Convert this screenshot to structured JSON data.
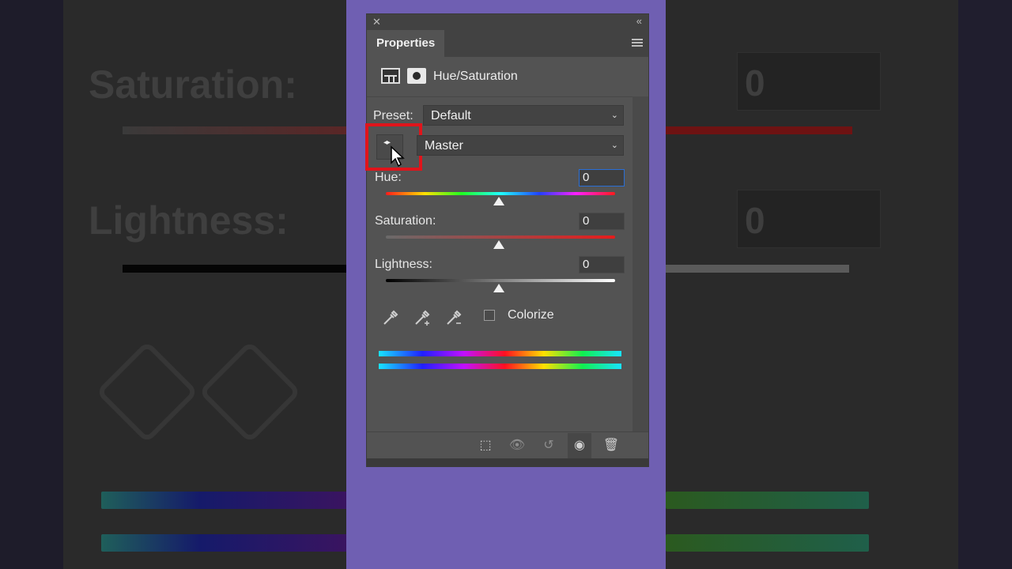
{
  "background": {
    "saturation_label": "Saturation:",
    "lightness_label": "Lightness:",
    "saturation_value": "0",
    "lightness_value": "0"
  },
  "panel": {
    "tab_title": "Properties",
    "adjustment_name": "Hue/Saturation",
    "preset_label": "Preset:",
    "preset_value": "Default",
    "channel_value": "Master",
    "hue_label": "Hue:",
    "hue_value": "0",
    "saturation_label": "Saturation:",
    "saturation_value": "0",
    "lightness_label": "Lightness:",
    "lightness_value": "0",
    "colorize_label": "Colorize",
    "colorize_checked": false
  },
  "icons": {
    "close": "close-icon",
    "collapse": "collapse-icon",
    "menu": "panel-menu-icon",
    "adjustment": "adjustment-layer-icon",
    "mask": "mask-icon",
    "target": "targeted-adjustment-tool-icon",
    "eyedroppers": [
      "eyedropper-icon",
      "eyedropper-plus-icon",
      "eyedropper-minus-icon"
    ],
    "footer": [
      "clip-to-layer-icon",
      "view-previous-state-icon",
      "reset-icon",
      "visibility-eye-icon",
      "trash-icon"
    ]
  },
  "colors": {
    "highlight": "#e0141b",
    "panel_bg": "#535353",
    "page_purple": "#6f5fb2"
  }
}
